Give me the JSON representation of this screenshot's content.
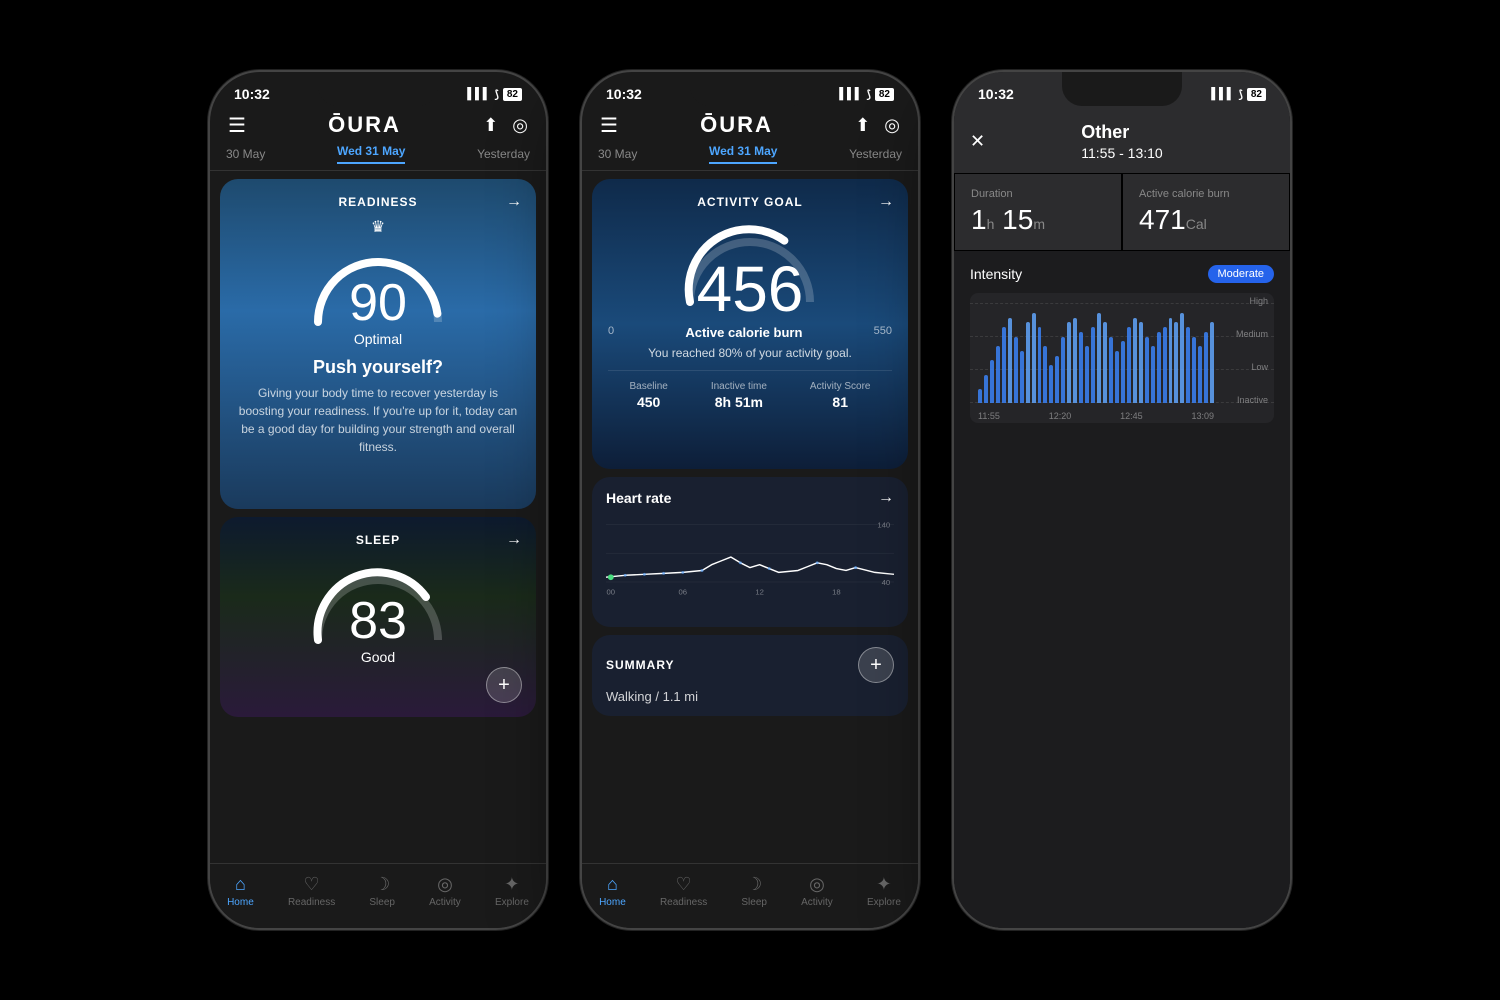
{
  "phone1": {
    "status": {
      "time": "10:32",
      "signal": "▌▌▌",
      "wifi": "⟆",
      "battery": "82"
    },
    "nav": {
      "menu": "☰",
      "logo": "ŌURA",
      "share": "↑",
      "ring": "◎"
    },
    "dates": {
      "prev": "30 May",
      "current": "Wed 31 May",
      "next": "Yesterday"
    },
    "readiness": {
      "title": "READINESS",
      "score": "90",
      "label": "Optimal",
      "heading": "Push yourself?",
      "body": "Giving your body time to recover yesterday is boosting your readiness. If you're up for it, today can be a good day for building your strength and overall fitness."
    },
    "sleep": {
      "title": "SLEEP",
      "score": "83",
      "label": "Good"
    },
    "nav_items": [
      {
        "icon": "⌂",
        "label": "Home",
        "active": true
      },
      {
        "icon": "♡",
        "label": "Readiness",
        "active": false
      },
      {
        "icon": "☽",
        "label": "Sleep",
        "active": false
      },
      {
        "icon": "◎",
        "label": "Activity",
        "active": false
      },
      {
        "icon": "✦",
        "label": "Explore",
        "active": false
      }
    ]
  },
  "phone2": {
    "status": {
      "time": "10:32",
      "battery": "82"
    },
    "dates": {
      "prev": "30 May",
      "current": "Wed 31 May",
      "next": "Yesterday"
    },
    "activity": {
      "title": "ACTIVITY GOAL",
      "score": "456",
      "label": "Active calorie burn",
      "range_min": "0",
      "range_max": "550",
      "desc": "You reached 80% of your activity goal.",
      "baseline_label": "Baseline",
      "baseline_value": "450",
      "inactive_label": "Inactive time",
      "inactive_value": "8h 51m",
      "score_label": "Activity Score",
      "score_value": "81"
    },
    "heartrate": {
      "title": "Heart rate",
      "labels": [
        "00",
        "06",
        "12",
        "18"
      ],
      "range_high": "140",
      "range_low": "40"
    },
    "summary": {
      "title": "SUMMARY",
      "item": "Walking / 1.1 mi"
    },
    "nav_items": [
      {
        "icon": "⌂",
        "label": "Home",
        "active": true
      },
      {
        "icon": "♡",
        "label": "Readiness",
        "active": false
      },
      {
        "icon": "☽",
        "label": "Sleep",
        "active": false
      },
      {
        "icon": "◎",
        "label": "Activity",
        "active": false
      },
      {
        "icon": "✦",
        "label": "Explore",
        "active": false
      }
    ]
  },
  "phone3": {
    "status": {
      "time": "10:32",
      "battery": "82"
    },
    "detail": {
      "title": "Other",
      "time": "11:55 - 13:10",
      "duration_label": "Duration",
      "duration_value": "1",
      "duration_h": "h",
      "duration_m_val": "15",
      "duration_m": "m",
      "calorie_label": "Active calorie burn",
      "calorie_value": "471",
      "calorie_unit": "Cal",
      "intensity_label": "Intensity",
      "intensity_badge": "Moderate",
      "chart_labels": {
        "high": "High",
        "medium": "Medium",
        "low": "Low",
        "inactive": "Inactive"
      },
      "x_labels": [
        "11:55",
        "12:20",
        "12:45",
        "13:09"
      ]
    },
    "bars": [
      15,
      30,
      45,
      60,
      80,
      90,
      70,
      55,
      85,
      95,
      80,
      60,
      40,
      50,
      70,
      85,
      90,
      75,
      60,
      80,
      95,
      85,
      70,
      55,
      65,
      80,
      90,
      85,
      70,
      60,
      75,
      80,
      90,
      85,
      95,
      80,
      70,
      60,
      75,
      85
    ]
  }
}
